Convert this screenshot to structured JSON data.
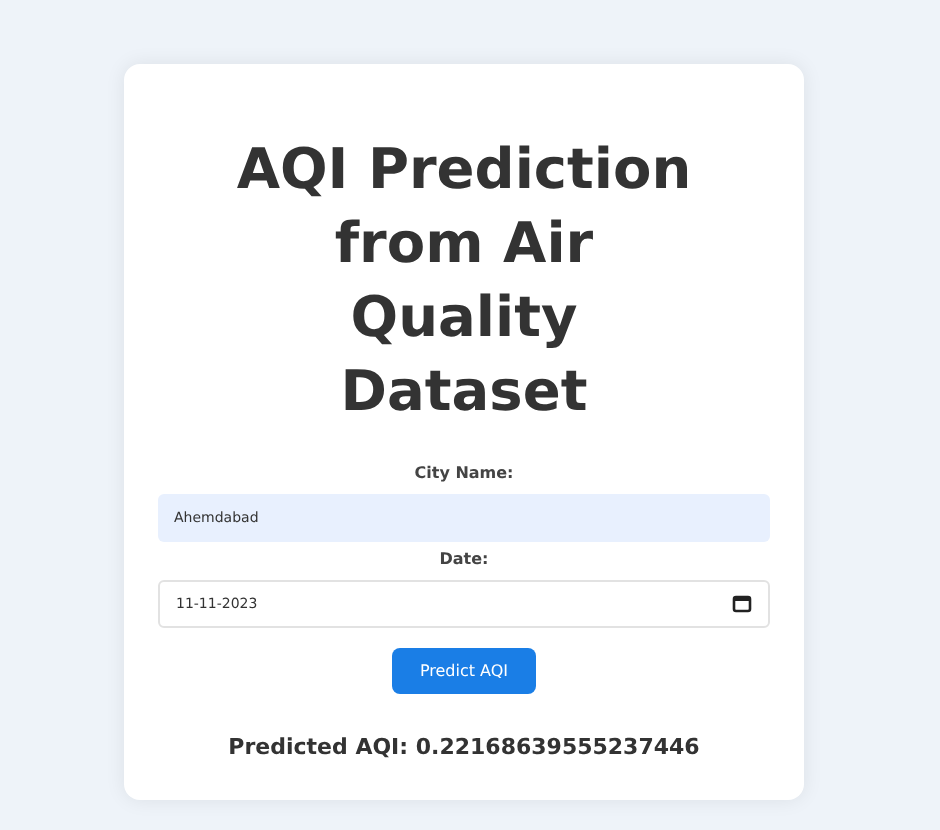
{
  "title": "AQI Prediction from Air Quality Dataset",
  "fields": [
    {
      "kind": "text",
      "label": "City Name:",
      "value": "Ahemdabad"
    },
    {
      "kind": "date",
      "label": "Date:",
      "value": "11-11-2023"
    }
  ],
  "button": "Predict AQI",
  "result": "Predicted AQI: 0.22168639555237446"
}
